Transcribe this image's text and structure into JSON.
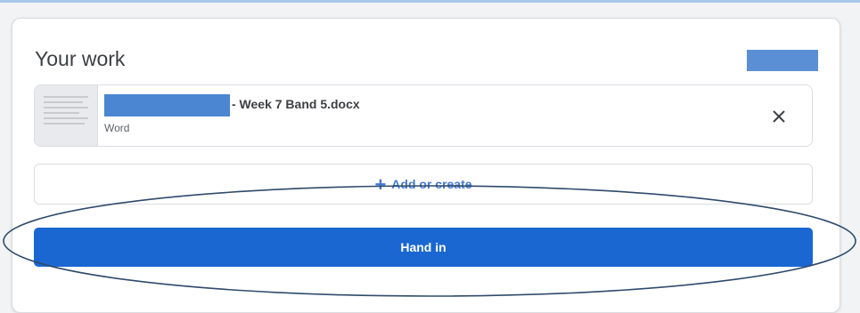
{
  "your_work": {
    "title": "Your work",
    "attachment": {
      "file_name": "- Week 7 Band 5.docx",
      "file_type": "Word",
      "remove_icon": "close-icon"
    },
    "add_or_create": {
      "icon": "plus-icon",
      "label": "Add or create"
    },
    "hand_in_label": "Hand in"
  },
  "colors": {
    "primary": "#1a67d2",
    "link": "#4479d6",
    "redaction": "#4a86d1",
    "annotation": "#2f4a6b"
  }
}
